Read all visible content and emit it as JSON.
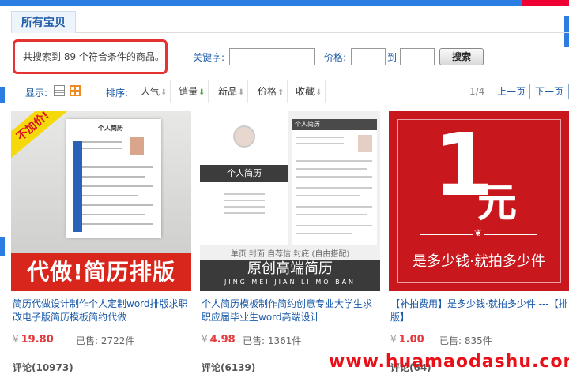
{
  "page": {
    "title": "所有宝贝"
  },
  "search": {
    "result_text": "共搜索到 89 个符合条件的商品。",
    "keyword_label": "关键字:",
    "keyword_value": "",
    "price_label": "价格:",
    "price_min": "",
    "price_to": "到",
    "price_max": "",
    "submit_label": "搜索"
  },
  "toolbar": {
    "display_label": "显示:",
    "sort_label": "排序:",
    "sort_options": [
      "人气",
      "销量",
      "新品",
      "价格",
      "收藏"
    ],
    "active_sort": "销量",
    "page_indicator": "1/4",
    "prev_label": "上一页",
    "next_label": "下一页"
  },
  "products": [
    {
      "title": "简历代做设计制作个人定制word排版求职改电子版简历模板简约代做",
      "currency": "¥",
      "price": "19.80",
      "sold_label": "已售:",
      "sold": "2722件",
      "reviews": "评论(10973)",
      "image_badge": "不加价!",
      "image_banner": "代做!简历排版",
      "image_doc_title": "个人简历"
    },
    {
      "title": "个人简历模板制作简约创意专业大学生求职应届毕业生word高端设计",
      "currency": "¥",
      "price": "4.98",
      "sold_label": "已售:",
      "sold": "1361件",
      "reviews": "评论(6139)",
      "image_band": "个人简历",
      "image_sub": "单页 封面 自荐信 封底 (自由搭配)",
      "image_big": "原创高端简历",
      "image_pinyin": "JING MEI JIAN LI MO BAN",
      "image_doc_title": "个人简历"
    },
    {
      "title": "【补拍费用】是多少钱·就拍多少件 ---【排版】",
      "currency": "¥",
      "price": "1.00",
      "sold_label": "已售:",
      "sold": "835件",
      "reviews": "评论(64)",
      "image_big": "1",
      "image_unit": "元",
      "image_tagline": "是多少钱·就拍多少件"
    }
  ],
  "watermark": "www.huamaodashu.com",
  "colors": {
    "accent": "#1a5aa8",
    "price": "#e4393c",
    "highlight": "#e53333"
  }
}
